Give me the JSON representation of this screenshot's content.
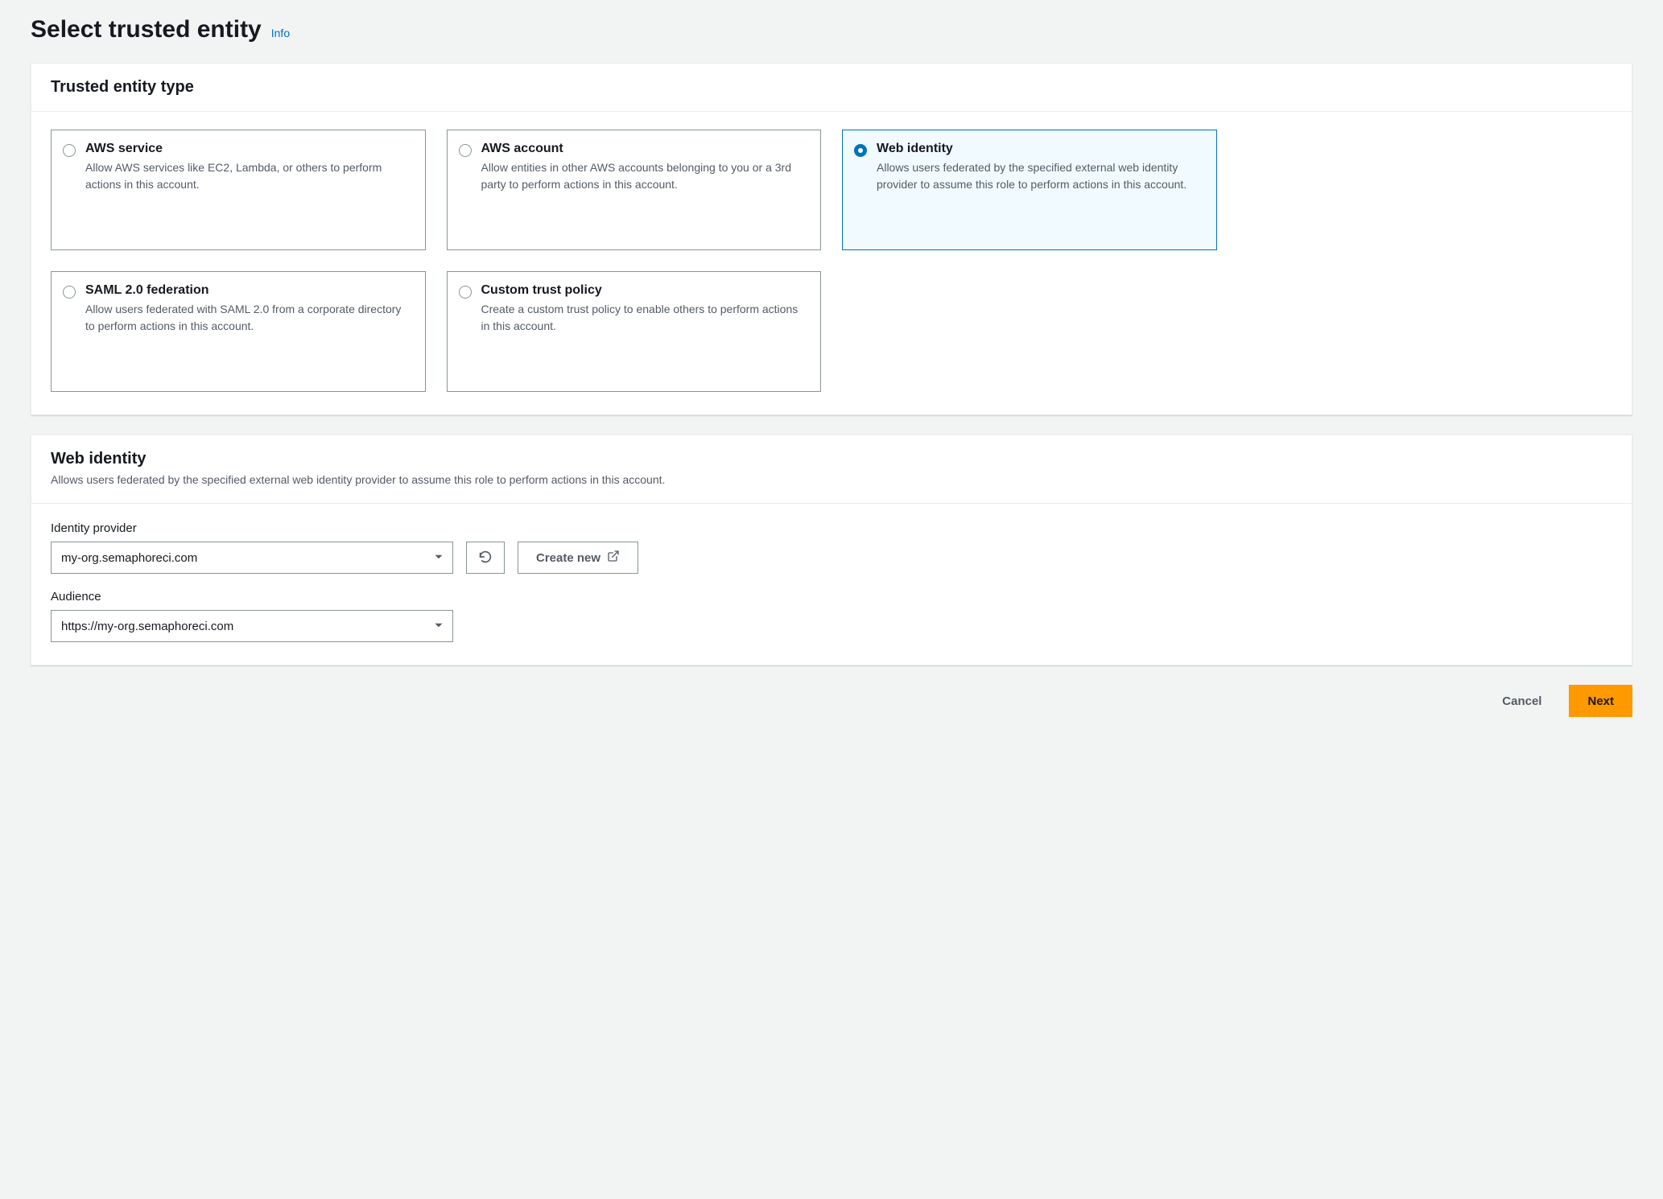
{
  "page": {
    "title": "Select trusted entity",
    "info_link": "Info"
  },
  "trusted_entity": {
    "panel_title": "Trusted entity type",
    "selected": "web-identity",
    "options": [
      {
        "id": "aws-service",
        "label": "AWS service",
        "description": "Allow AWS services like EC2, Lambda, or others to perform actions in this account."
      },
      {
        "id": "aws-account",
        "label": "AWS account",
        "description": "Allow entities in other AWS accounts belonging to you or a 3rd party to perform actions in this account."
      },
      {
        "id": "web-identity",
        "label": "Web identity",
        "description": "Allows users federated by the specified external web identity provider to assume this role to perform actions in this account."
      },
      {
        "id": "saml-federation",
        "label": "SAML 2.0 federation",
        "description": "Allow users federated with SAML 2.0 from a corporate directory to perform actions in this account."
      },
      {
        "id": "custom-trust-policy",
        "label": "Custom trust policy",
        "description": "Create a custom trust policy to enable others to perform actions in this account."
      }
    ]
  },
  "web_identity": {
    "panel_title": "Web identity",
    "panel_subtitle": "Allows users federated by the specified external web identity provider to assume this role to perform actions in this account.",
    "identity_provider": {
      "label": "Identity provider",
      "value": "my-org.semaphoreci.com"
    },
    "audience": {
      "label": "Audience",
      "value": "https://my-org.semaphoreci.com"
    },
    "create_new_label": "Create new"
  },
  "footer": {
    "cancel": "Cancel",
    "next": "Next"
  }
}
